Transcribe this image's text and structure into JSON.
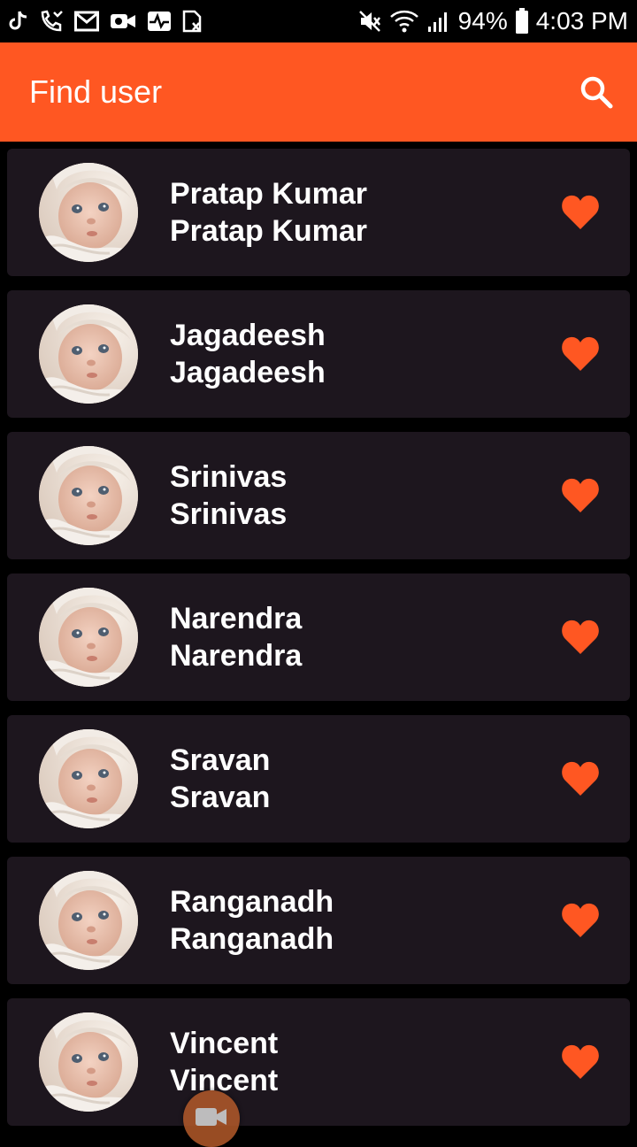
{
  "status_bar": {
    "battery": "94%",
    "time": "4:03 PM",
    "left_icons": [
      "tiktok-icon",
      "missed-call-icon",
      "gmail-icon",
      "video-camera-icon",
      "activity-icon",
      "sim-icon"
    ],
    "right_icons": [
      "mute-icon",
      "wifi-icon",
      "signal-icon",
      "battery-icon"
    ]
  },
  "app_bar": {
    "title": "Find user",
    "search_icon": "search-icon",
    "color": "#ff5722"
  },
  "users": [
    {
      "name": "Pratap Kumar",
      "subtitle": "Pratap Kumar"
    },
    {
      "name": "Jagadeesh",
      "subtitle": "Jagadeesh"
    },
    {
      "name": "Srinivas",
      "subtitle": "Srinivas"
    },
    {
      "name": "Narendra",
      "subtitle": "Narendra"
    },
    {
      "name": "Sravan",
      "subtitle": "Sravan"
    },
    {
      "name": "Ranganadh",
      "subtitle": "Ranganadh"
    },
    {
      "name": "Vincent",
      "subtitle": "Vincent"
    }
  ],
  "colors": {
    "accent": "#ff5722",
    "card_background": "#1d161e",
    "heart": "#ff5722",
    "page_background": "#000000"
  },
  "fab": {
    "icon": "video-camera-icon"
  }
}
